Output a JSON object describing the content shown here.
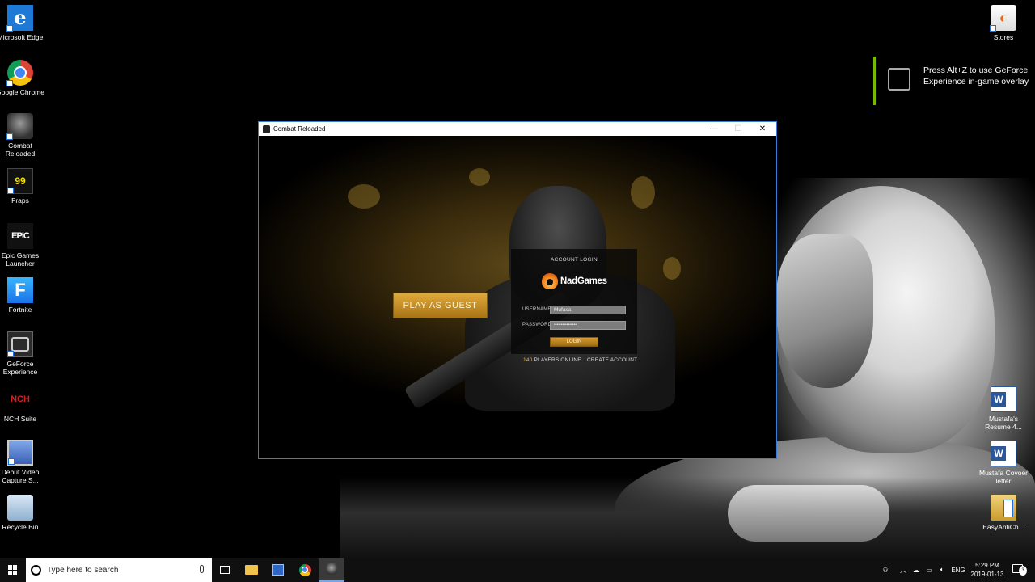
{
  "desktop": {
    "left_icons": [
      {
        "label": "Microsoft Edge",
        "glyph": "e",
        "icon": "edge-icon"
      },
      {
        "label": "Google Chrome",
        "glyph": "",
        "icon": "chrome-icon"
      },
      {
        "label": "Combat Reloaded",
        "glyph": "",
        "icon": "combat-reloaded-icon"
      },
      {
        "label": "Fraps",
        "glyph": "99",
        "icon": "fraps-icon"
      },
      {
        "label": "Epic Games Launcher",
        "glyph": "EPIC",
        "icon": "epic-games-icon"
      },
      {
        "label": "Fortnite",
        "glyph": "F",
        "icon": "fortnite-icon"
      },
      {
        "label": "GeForce Experience",
        "glyph": "",
        "icon": "geforce-icon"
      },
      {
        "label": "NCH Suite",
        "glyph": "NCH",
        "icon": "nch-icon"
      },
      {
        "label": "Debut Video Capture S...",
        "glyph": "",
        "icon": "debut-icon"
      },
      {
        "label": "Recycle Bin",
        "glyph": "",
        "icon": "recycle-bin-icon"
      }
    ],
    "right_icons": [
      {
        "label": "Stores",
        "glyph": "",
        "icon": "stores-icon"
      },
      {
        "label": "Mustafa's Resume 4...",
        "glyph": "",
        "icon": "word-doc-icon"
      },
      {
        "label": "Mustafa Covoer letter",
        "glyph": "",
        "icon": "word-doc-icon"
      },
      {
        "label": "EasyAntiCh...",
        "glyph": "",
        "icon": "easyanticheat-icon"
      }
    ]
  },
  "geforce_notification": {
    "text": "Press Alt+Z to use GeForce Experience in-game overlay"
  },
  "window": {
    "title": "Combat Reloaded",
    "minimize": "—",
    "maximize": "☐",
    "close": "✕"
  },
  "game": {
    "play_as_guest": "PLAY AS GUEST",
    "login_panel": {
      "title": "ACCOUNT LOGIN",
      "logo_text": "NadGames",
      "username_label": "USERNAME",
      "username_value": "Mufasa",
      "password_label": "PASSWORD",
      "password_value": "••••••••••••••••",
      "login_button": "LOGIN"
    },
    "players_online_count": "140",
    "players_online_label": "PLAYERS ONLINE",
    "create_account": "CREATE ACCOUNT"
  },
  "taskbar": {
    "search_placeholder": "Type here to search",
    "tray": {
      "language": "ENG",
      "time": "5:29 PM",
      "date": "2019-01-13",
      "notification_count": "3"
    }
  },
  "colors": {
    "accent_gold": "#e2b040",
    "nvidia_green": "#76b900",
    "window_border": "#3a7bd5"
  }
}
